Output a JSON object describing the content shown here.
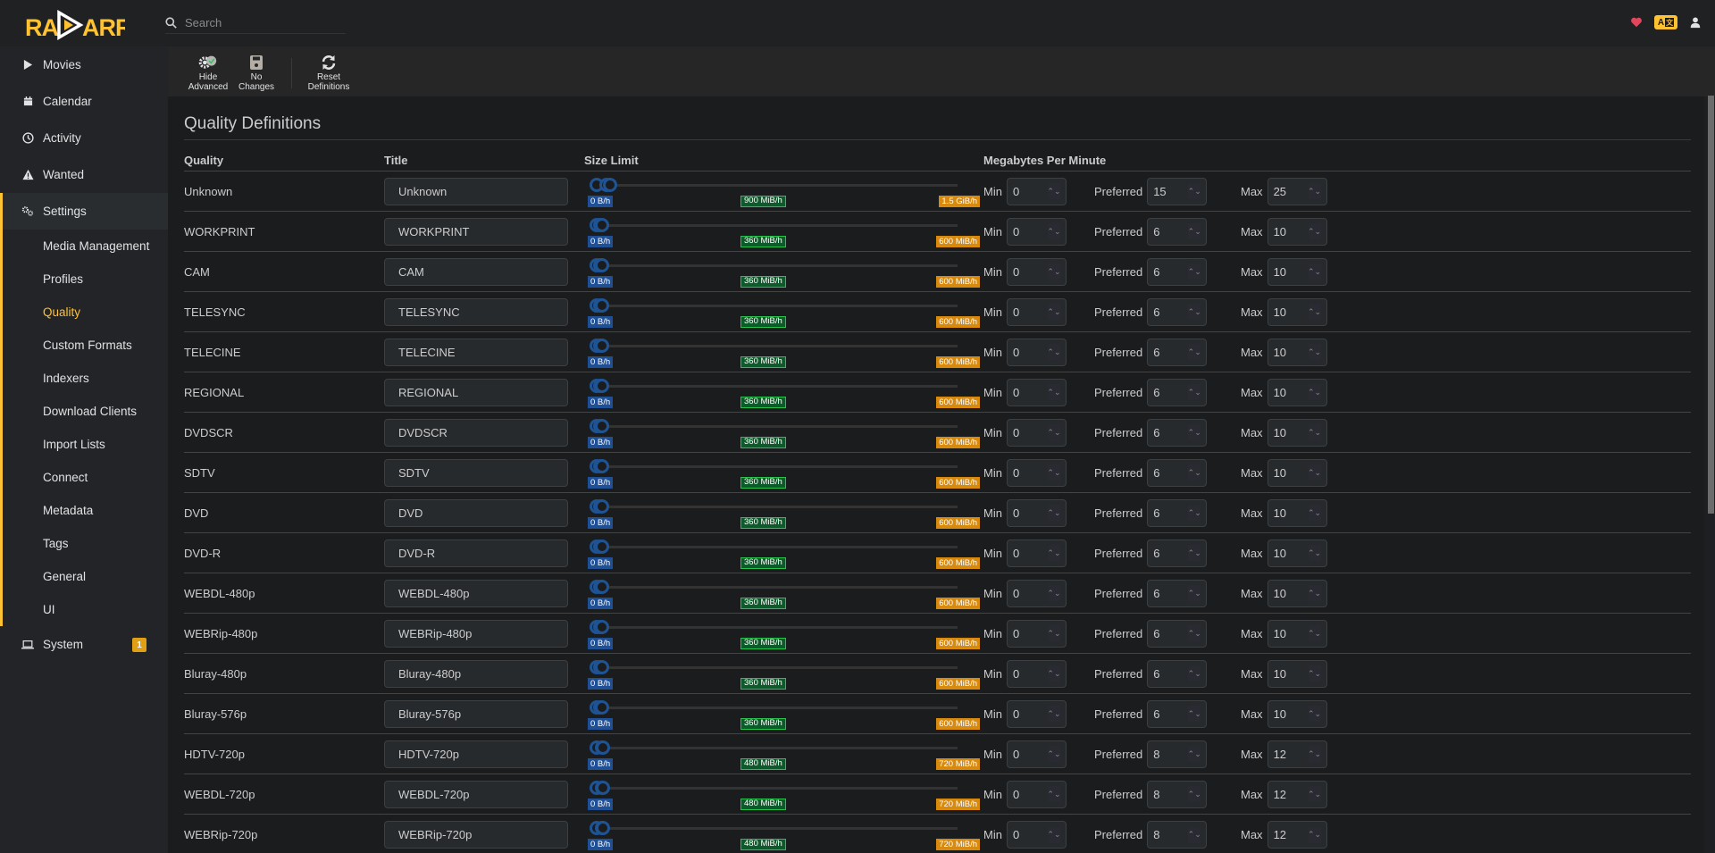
{
  "app": {
    "name": "Radarr",
    "accent_color": "#ffc230"
  },
  "header": {
    "search_placeholder": "Search",
    "icons": [
      "heart-icon",
      "translate-icon",
      "user-icon"
    ]
  },
  "sidebar": {
    "items": [
      {
        "label": "Movies",
        "icon": "play-icon"
      },
      {
        "label": "Calendar",
        "icon": "calendar-icon"
      },
      {
        "label": "Activity",
        "icon": "clock-icon"
      },
      {
        "label": "Wanted",
        "icon": "warning-icon"
      },
      {
        "label": "Settings",
        "icon": "cogs-icon"
      }
    ],
    "settings_sub": [
      "Media Management",
      "Profiles",
      "Quality",
      "Custom Formats",
      "Indexers",
      "Download Clients",
      "Import Lists",
      "Connect",
      "Metadata",
      "Tags",
      "General",
      "UI"
    ],
    "current_sub": "Quality",
    "system": {
      "label": "System",
      "icon": "laptop-icon",
      "badge": "1"
    }
  },
  "toolbar": {
    "hide_advanced": [
      "Hide",
      "Advanced"
    ],
    "no_changes": [
      "No",
      "Changes"
    ],
    "reset_definitions": [
      "Reset",
      "Definitions"
    ]
  },
  "page": {
    "title": "Quality Definitions",
    "columns": {
      "quality": "Quality",
      "title": "Title",
      "size_limit": "Size Limit",
      "mbpm": "Megabytes Per Minute"
    },
    "labels": {
      "min": "Min",
      "preferred": "Preferred",
      "max": "Max"
    },
    "rows": [
      {
        "quality": "Unknown",
        "title": "Unknown",
        "min_label": "0 B/h",
        "pref_label": "900 MiB/h",
        "max_label": "1.5 GiB/h",
        "min": "0",
        "preferred": "15",
        "max": "25"
      },
      {
        "quality": "WORKPRINT",
        "title": "WORKPRINT",
        "min_label": "0 B/h",
        "pref_label": "360 MiB/h",
        "max_label": "600 MiB/h",
        "min": "0",
        "preferred": "6",
        "max": "10"
      },
      {
        "quality": "CAM",
        "title": "CAM",
        "min_label": "0 B/h",
        "pref_label": "360 MiB/h",
        "max_label": "600 MiB/h",
        "min": "0",
        "preferred": "6",
        "max": "10"
      },
      {
        "quality": "TELESYNC",
        "title": "TELESYNC",
        "min_label": "0 B/h",
        "pref_label": "360 MiB/h",
        "max_label": "600 MiB/h",
        "min": "0",
        "preferred": "6",
        "max": "10"
      },
      {
        "quality": "TELECINE",
        "title": "TELECINE",
        "min_label": "0 B/h",
        "pref_label": "360 MiB/h",
        "max_label": "600 MiB/h",
        "min": "0",
        "preferred": "6",
        "max": "10"
      },
      {
        "quality": "REGIONAL",
        "title": "REGIONAL",
        "min_label": "0 B/h",
        "pref_label": "360 MiB/h",
        "max_label": "600 MiB/h",
        "min": "0",
        "preferred": "6",
        "max": "10"
      },
      {
        "quality": "DVDSCR",
        "title": "DVDSCR",
        "min_label": "0 B/h",
        "pref_label": "360 MiB/h",
        "max_label": "600 MiB/h",
        "min": "0",
        "preferred": "6",
        "max": "10"
      },
      {
        "quality": "SDTV",
        "title": "SDTV",
        "min_label": "0 B/h",
        "pref_label": "360 MiB/h",
        "max_label": "600 MiB/h",
        "min": "0",
        "preferred": "6",
        "max": "10"
      },
      {
        "quality": "DVD",
        "title": "DVD",
        "min_label": "0 B/h",
        "pref_label": "360 MiB/h",
        "max_label": "600 MiB/h",
        "min": "0",
        "preferred": "6",
        "max": "10"
      },
      {
        "quality": "DVD-R",
        "title": "DVD-R",
        "min_label": "0 B/h",
        "pref_label": "360 MiB/h",
        "max_label": "600 MiB/h",
        "min": "0",
        "preferred": "6",
        "max": "10"
      },
      {
        "quality": "WEBDL-480p",
        "title": "WEBDL-480p",
        "min_label": "0 B/h",
        "pref_label": "360 MiB/h",
        "max_label": "600 MiB/h",
        "min": "0",
        "preferred": "6",
        "max": "10"
      },
      {
        "quality": "WEBRip-480p",
        "title": "WEBRip-480p",
        "min_label": "0 B/h",
        "pref_label": "360 MiB/h",
        "max_label": "600 MiB/h",
        "min": "0",
        "preferred": "6",
        "max": "10"
      },
      {
        "quality": "Bluray-480p",
        "title": "Bluray-480p",
        "min_label": "0 B/h",
        "pref_label": "360 MiB/h",
        "max_label": "600 MiB/h",
        "min": "0",
        "preferred": "6",
        "max": "10"
      },
      {
        "quality": "Bluray-576p",
        "title": "Bluray-576p",
        "min_label": "0 B/h",
        "pref_label": "360 MiB/h",
        "max_label": "600 MiB/h",
        "min": "0",
        "preferred": "6",
        "max": "10"
      },
      {
        "quality": "HDTV-720p",
        "title": "HDTV-720p",
        "min_label": "0 B/h",
        "pref_label": "480 MiB/h",
        "max_label": "720 MiB/h",
        "min": "0",
        "preferred": "8",
        "max": "12"
      },
      {
        "quality": "WEBDL-720p",
        "title": "WEBDL-720p",
        "min_label": "0 B/h",
        "pref_label": "480 MiB/h",
        "max_label": "720 MiB/h",
        "min": "0",
        "preferred": "8",
        "max": "12"
      },
      {
        "quality": "WEBRip-720p",
        "title": "WEBRip-720p",
        "min_label": "0 B/h",
        "pref_label": "480 MiB/h",
        "max_label": "720 MiB/h",
        "min": "0",
        "preferred": "8",
        "max": "12"
      }
    ],
    "slider_max_mbpm": 400
  }
}
